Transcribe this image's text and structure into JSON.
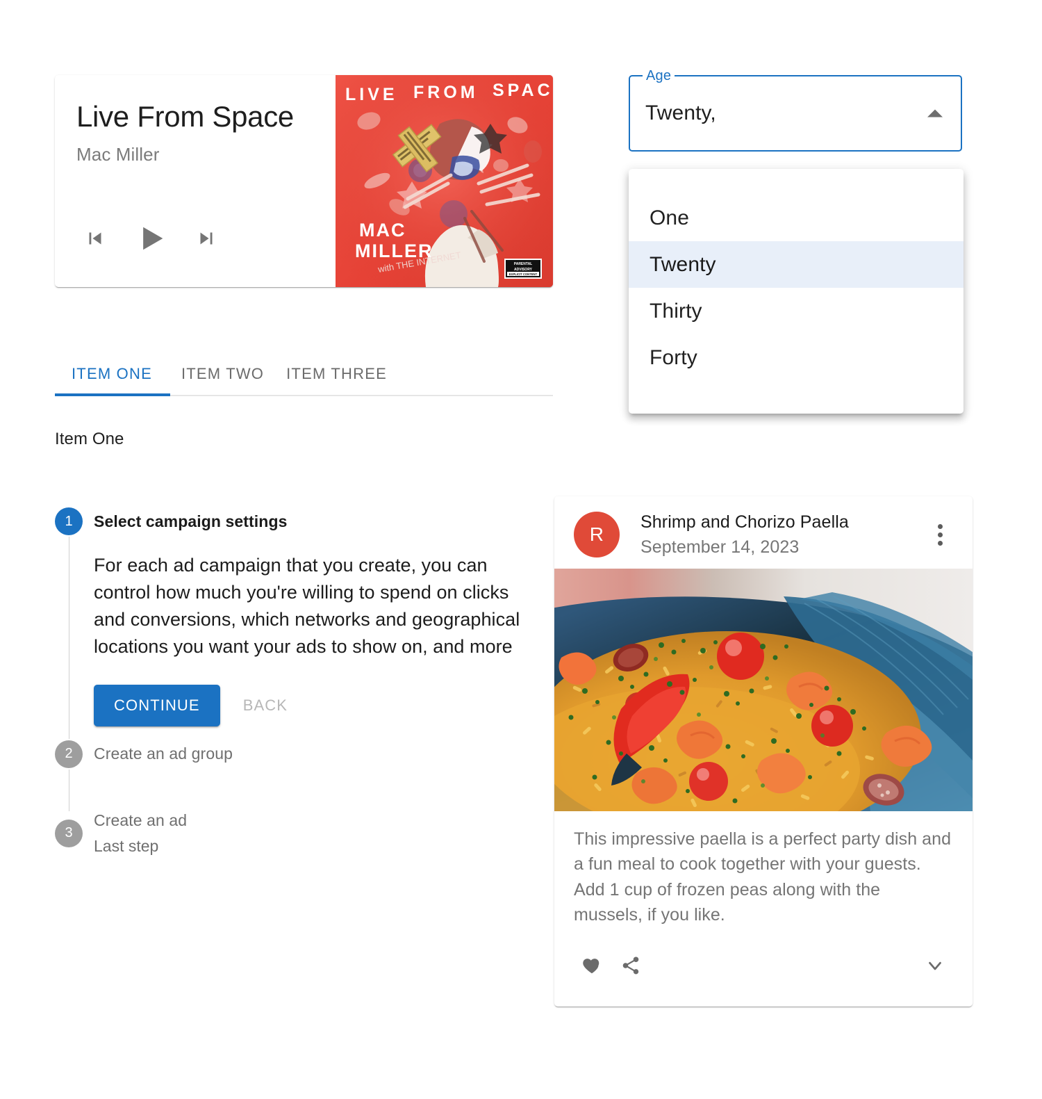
{
  "music_card": {
    "title": "Live From Space",
    "artist": "Mac Miller",
    "controls": {
      "previous": "skip-previous",
      "play": "play-arrow",
      "next": "skip-next"
    },
    "album_art": {
      "alt": "Live From Space album cover",
      "cover_text_top": "LIVE FROM SPACE",
      "cover_text_artist": "MAC MILLER",
      "cover_text_sub": "with THE INTERNET",
      "advisory_badge": "PARENTAL ADVISORY EXPLICIT CONTENT",
      "background_color": "#e8473c"
    }
  },
  "select": {
    "label": "Age",
    "value": "Twenty,",
    "arrow_icon": "arrow-up-icon",
    "options": [
      {
        "label": "One",
        "selected": false
      },
      {
        "label": "Twenty",
        "selected": true
      },
      {
        "label": "Thirty",
        "selected": false
      },
      {
        "label": "Forty",
        "selected": false
      }
    ],
    "accent_color": "#1b72c2",
    "selected_row_color": "#e8eff9"
  },
  "tabs": {
    "items": [
      {
        "label": "ITEM ONE",
        "active": true
      },
      {
        "label": "ITEM TWO",
        "active": false
      },
      {
        "label": "ITEM THREE",
        "active": false
      }
    ],
    "panel_text": "Item One",
    "active_color": "#1b72c2",
    "inactive_color": "#6b6b6b"
  },
  "stepper": {
    "steps": [
      {
        "number": "1",
        "title": "Select campaign settings",
        "active": true,
        "body": "For each ad campaign that you create, you can control how much you're willing to spend on clicks and conversions, which networks and geographical locations you want your ads to show on, and more",
        "continue_label": "CONTINUE",
        "back_label": "BACK"
      },
      {
        "number": "2",
        "title": "Create an ad group",
        "active": false
      },
      {
        "number": "3",
        "title": "Create an ad",
        "optional": "Last step",
        "active": false
      }
    ],
    "active_color": "#1b72c2",
    "inactive_color": "#9e9e9e"
  },
  "recipe_card": {
    "avatar_letter": "R",
    "avatar_color": "#e04a38",
    "title": "Shrimp and Chorizo Paella",
    "date": "September 14, 2023",
    "more_icon": "more-vert-icon",
    "image_alt": "Shrimp and chorizo paella in a blue pan",
    "body": "This impressive paella is a perfect party dish and a fun meal to cook together with your guests. Add 1 cup of frozen peas along with the mussels, if you like.",
    "actions": {
      "favorite": "heart-icon",
      "share": "share-icon",
      "expand": "chevron-down-icon"
    }
  }
}
